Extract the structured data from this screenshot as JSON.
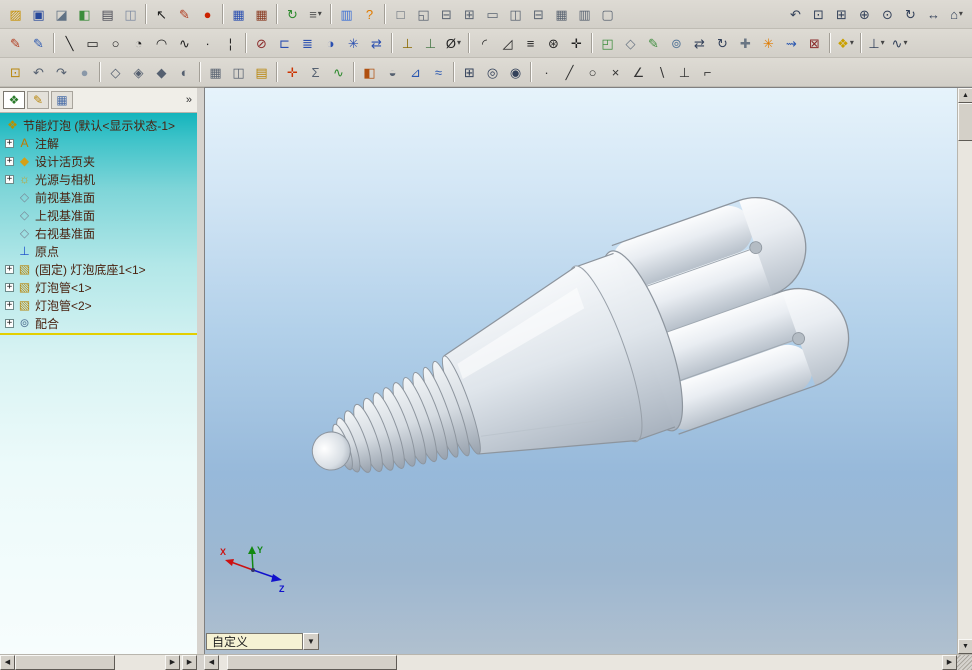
{
  "toolbars": {
    "rows": [
      {
        "id": "standard",
        "groups": [
          [
            [
              "open",
              "▨",
              "#c79000"
            ],
            [
              "save",
              "▣",
              "#27489b"
            ],
            [
              "make-drawing",
              "◪",
              "#607285"
            ],
            [
              "make-assembly",
              "◧",
              "#3c8d3c"
            ],
            [
              "print",
              "▤",
              "#4a4a55"
            ],
            [
              "print-preview",
              "◫",
              "#7d8aa0"
            ]
          ],
          [
            [
              "select",
              "↖",
              "#1a1a1a"
            ],
            [
              "sketch-entity",
              "✎",
              "#b03a1e"
            ],
            [
              "record-macro",
              "●",
              "#cc2200"
            ]
          ],
          [
            [
              "design-table",
              "▦",
              "#2a4fb0"
            ],
            [
              "bom-table",
              "▦",
              "#8a3b22"
            ]
          ],
          [
            [
              "rebuild",
              "↻",
              "#2d8a2d"
            ],
            [
              "options",
              "≡",
              "#555555",
              true
            ]
          ],
          [
            [
              "file-properties",
              "▥",
              "#3b6fd4"
            ],
            [
              "help",
              "?",
              "#e07b00"
            ]
          ],
          [
            [
              "new-window",
              "□",
              "#5a6472"
            ],
            [
              "cascade-windows",
              "◱",
              "#5a6472"
            ],
            [
              "tile-horizontally",
              "⊟",
              "#5a6472"
            ],
            [
              "tile-vertically",
              "⊞",
              "#5a6472"
            ],
            [
              "single-viewport",
              "▭",
              "#5a6472"
            ],
            [
              "two-viewports-vertical",
              "◫",
              "#5a6472"
            ],
            [
              "two-viewports-horizontal",
              "⊟",
              "#5a6472"
            ],
            [
              "four-viewports",
              "▦",
              "#5a6472"
            ],
            [
              "arrange-windows",
              "▥",
              "#5a6472"
            ],
            [
              "close-all-windows",
              "▢",
              "#5a6472"
            ]
          ]
        ],
        "right_groups": [
          [
            [
              "previous-view",
              "↶",
              "#33415a"
            ],
            [
              "zoom-to-fit",
              "⊡",
              "#33415a"
            ],
            [
              "zoom-to-area",
              "⊞",
              "#33415a"
            ],
            [
              "zoom-in-out",
              "⊕",
              "#33415a"
            ],
            [
              "zoom-to-selection",
              "⊙",
              "#33415a"
            ],
            [
              "rotate-view",
              "↻",
              "#33415a"
            ],
            [
              "pan",
              "↔",
              "#33415a"
            ],
            [
              "standard-views",
              "⌂",
              "#33415a",
              true
            ]
          ]
        ]
      },
      {
        "id": "sketch",
        "groups": [
          [
            [
              "sketch",
              "✎",
              "#b03a1e"
            ],
            [
              "3d-sketch",
              "✎",
              "#2b58b0"
            ]
          ],
          [
            [
              "line",
              "╲",
              "#222222"
            ],
            [
              "rectangle",
              "▭",
              "#222222"
            ],
            [
              "circle",
              "○",
              "#222222"
            ],
            [
              "centerpoint-arc",
              "◔",
              "#222222"
            ],
            [
              "tangent-arc",
              "◠",
              "#222222"
            ],
            [
              "spline",
              "∿",
              "#222222"
            ],
            [
              "point",
              "∙",
              "#222222"
            ],
            [
              "centerline",
              "¦",
              "#222222"
            ]
          ],
          [
            [
              "trim-entities",
              "⊘",
              "#8a2a2a"
            ],
            [
              "convert-entities",
              "⊏",
              "#2a4fb0"
            ],
            [
              "offset-entities",
              "≣",
              "#2a4fb0"
            ],
            [
              "mirror-entities",
              "◑",
              "#2a4fb0"
            ],
            [
              "linear-sketch-pattern",
              "✳",
              "#2a4fb0"
            ],
            [
              "move-entities",
              "⇄",
              "#2a4fb0"
            ]
          ],
          [
            [
              "add-relation",
              "⊥",
              "#8a6a00"
            ],
            [
              "display-relations",
              "⊥",
              "#4a7a4a"
            ],
            [
              "smart-dimension",
              "Ø",
              "#222222",
              true
            ]
          ],
          [
            [
              "sketch-fillet",
              "◜",
              "#222222"
            ],
            [
              "sketch-chamfer",
              "◿",
              "#222222"
            ],
            [
              "linear-pattern",
              "≡",
              "#222222"
            ],
            [
              "circular-pattern",
              "⊛",
              "#222222"
            ],
            [
              "modify-sketch",
              "✛",
              "#222222"
            ]
          ],
          [
            [
              "insert-component",
              "◰",
              "#3c8d3c"
            ],
            [
              "hide-show-component",
              "◇",
              "#6a7684"
            ],
            [
              "edit-component",
              "✎",
              "#3c8d3c"
            ],
            [
              "mate",
              "⊚",
              "#5a7a9a"
            ],
            [
              "move-component",
              "⇄",
              "#33415a"
            ],
            [
              "rotate-component",
              "↻",
              "#33415a"
            ],
            [
              "smart-fasteners",
              "✚",
              "#6a7684"
            ],
            [
              "exploded-view",
              "✳",
              "#e07b00"
            ],
            [
              "explode-line-sketch",
              "⇝",
              "#2b58b0"
            ],
            [
              "interference-detection",
              "⊠",
              "#8a2a2a"
            ]
          ],
          [
            [
              "appearances",
              "❖",
              "#caa000",
              true
            ]
          ],
          [
            [
              "reference-geometry",
              "⊥",
              "#33415a",
              true
            ],
            [
              "curves",
              "∿",
              "#33415a",
              true
            ]
          ]
        ]
      },
      {
        "id": "view",
        "groups": [
          [
            [
              "view-palette",
              "⊡",
              "#b8860b"
            ],
            [
              "view-previous",
              "↶",
              "#556070"
            ],
            [
              "view-next",
              "↷",
              "#556070"
            ],
            [
              "shaded",
              "●",
              "#8a98a8"
            ]
          ],
          [
            [
              "wireframe",
              "◇",
              "#556070"
            ],
            [
              "hidden-lines-visible",
              "◈",
              "#556070"
            ],
            [
              "hidden-lines-removed",
              "◆",
              "#556070"
            ],
            [
              "shadows",
              "◐",
              "#556070"
            ]
          ],
          [
            [
              "grid-settings",
              "▦",
              "#5a6472"
            ],
            [
              "multi-page",
              "◫",
              "#5a6472"
            ],
            [
              "design-journal",
              "▤",
              "#b8860b"
            ]
          ],
          [
            [
              "measure",
              "✛",
              "#cc3300"
            ],
            [
              "mass-properties",
              "Σ",
              "#556070"
            ],
            [
              "curvature",
              "∿",
              "#2d8a2d"
            ]
          ],
          [
            [
              "section-view",
              "◧",
              "#b05010"
            ],
            [
              "transparency",
              "◒",
              "#556070"
            ],
            [
              "draft-analysis",
              "⊿",
              "#2b58b0"
            ],
            [
              "zebra-stripes",
              "≈",
              "#2b58b0"
            ]
          ],
          [
            [
              "view-orientation",
              "⊞",
              "#33415a"
            ],
            [
              "camera-view",
              "◎",
              "#33415a"
            ],
            [
              "display-settings",
              "◉",
              "#33415a"
            ]
          ],
          [
            [
              "filter-vertices",
              "·",
              "#333333"
            ],
            [
              "filter-edges",
              "╱",
              "#333333"
            ],
            [
              "filter-faces",
              "○",
              "#333333"
            ],
            [
              "filter-dimensions",
              "×",
              "#333333"
            ],
            [
              "filter-annotations",
              "∠",
              "#333333"
            ],
            [
              "filter-axes",
              "∖",
              "#333333"
            ],
            [
              "filter-planes",
              "⊥",
              "#333333"
            ],
            [
              "filter-reset",
              "⌐",
              "#333333"
            ]
          ]
        ]
      }
    ]
  },
  "left_panel": {
    "chevron": "»",
    "tabs": [
      {
        "name": "featuremanager",
        "glyph": "❖",
        "color": "#2a7a2a"
      },
      {
        "name": "propertymanager",
        "glyph": "✎",
        "color": "#b8860b"
      },
      {
        "name": "configurationmanager",
        "glyph": "▦",
        "color": "#4a6ea8"
      }
    ],
    "tree": {
      "items": [
        {
          "id": "assembly-root",
          "label": "节能灯泡 (默认<显示状态-1>",
          "glyph": "❖",
          "color": "#b89000",
          "expand": "root"
        },
        {
          "id": "annotations",
          "label": "注解",
          "glyph": "A",
          "color": "#c07800",
          "expand": "plus"
        },
        {
          "id": "design-binder",
          "label": "设计活页夹",
          "glyph": "◆",
          "color": "#d4a017",
          "expand": "plus"
        },
        {
          "id": "lights-cameras",
          "label": "光源与相机",
          "glyph": "☼",
          "color": "#c8a020",
          "expand": "plus"
        },
        {
          "id": "front-plane",
          "label": "前视基准面",
          "glyph": "◇",
          "color": "#7a8a98",
          "expand": "none"
        },
        {
          "id": "top-plane",
          "label": "上视基准面",
          "glyph": "◇",
          "color": "#7a8a98",
          "expand": "none"
        },
        {
          "id": "right-plane",
          "label": "右视基准面",
          "glyph": "◇",
          "color": "#7a8a98",
          "expand": "none"
        },
        {
          "id": "origin",
          "label": "原点",
          "glyph": "⊥",
          "color": "#2255cc",
          "expand": "none"
        },
        {
          "id": "base-part",
          "label": "(固定) 灯泡底座1<1>",
          "glyph": "▧",
          "color": "#b8860b",
          "expand": "plus"
        },
        {
          "id": "tube-part-1",
          "label": "灯泡管<1>",
          "glyph": "▧",
          "color": "#b8860b",
          "expand": "plus"
        },
        {
          "id": "tube-part-2",
          "label": "灯泡管<2>",
          "glyph": "▧",
          "color": "#b8860b",
          "expand": "plus"
        },
        {
          "id": "mates",
          "label": "配合",
          "glyph": "⊚",
          "color": "#5a7a9a",
          "expand": "plus"
        }
      ]
    }
  },
  "viewport": {
    "model_name": "节能灯泡",
    "triad": {
      "x": "X",
      "y": "Y",
      "z": "Z"
    },
    "customize": {
      "label": "自定义",
      "arrow": "▼"
    }
  },
  "scrollbars": {
    "up": "▲",
    "down": "▼",
    "left": "◀",
    "right": "▶"
  },
  "colors": {
    "toolbar_bg": "#d6d3ce",
    "tree_bg_top": "#14b4bc",
    "tree_underline": "#e3cf00",
    "viewport_top": "#e6f3fb",
    "viewport_bottom": "#b0c0cf",
    "combo_bg": "#f6f2d4",
    "triad_x": "#cc1111",
    "triad_y": "#118811",
    "triad_z": "#1111cc"
  }
}
